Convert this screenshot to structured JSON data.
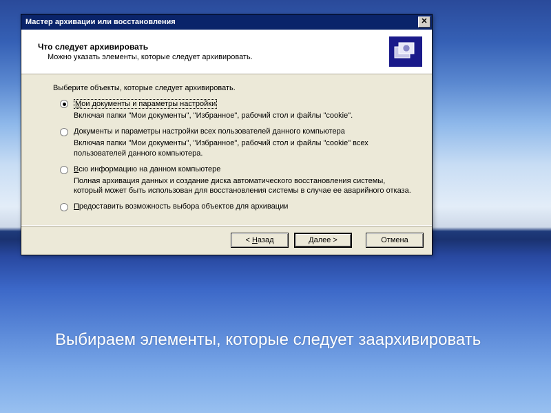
{
  "dialog": {
    "title": "Мастер архивации или восстановления",
    "header": {
      "title": "Что следует архивировать",
      "subtitle": "Можно указать элементы, которые следует архивировать."
    },
    "instruction": "Выберите объекты, которые следует архивировать.",
    "options": {
      "o1": {
        "key": "М",
        "rest": "ои документы и параметры настройки",
        "desc": "Включая папки \"Мои документы\", \"Избранное\", рабочий стол и файлы \"cookie\"."
      },
      "o2": {
        "key": "Д",
        "rest": "окументы и параметры настройки всех пользователей данного компьютера",
        "desc": "Включая папки \"Мои документы\", \"Избранное\", рабочий стол и файлы \"cookie\" всех пользователей данного компьютера."
      },
      "o3": {
        "key": "В",
        "rest": "сю информацию на данном компьютере",
        "desc": "Полная архивация данных и создание диска автоматического восстановления системы, который может быть использован для восстановления системы в случае ее аварийного отказа."
      },
      "o4": {
        "key": "П",
        "rest": "редоставить возможность выбора объектов для архивации"
      }
    },
    "buttons": {
      "back_key": "Н",
      "back_rest": "азад",
      "next_key": "Д",
      "next_rest": "алее",
      "cancel": "Отмена"
    }
  },
  "caption": "Выбираем элементы, которые следует заархивировать"
}
